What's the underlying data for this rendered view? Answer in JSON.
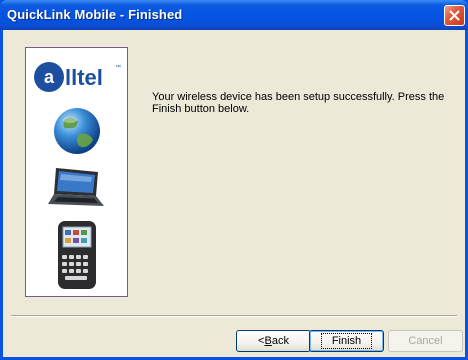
{
  "window": {
    "title": "QuickLink Mobile - Finished"
  },
  "content": {
    "message": "Your wireless device has been setup successfully.  Press the Finish button below."
  },
  "buttons": {
    "back": {
      "prefix": "< ",
      "mnemonic": "B",
      "rest": "ack"
    },
    "finish": "Finish",
    "cancel": "Cancel"
  },
  "brand": {
    "logo_text": "alltel",
    "color": "#1d4fa0"
  }
}
